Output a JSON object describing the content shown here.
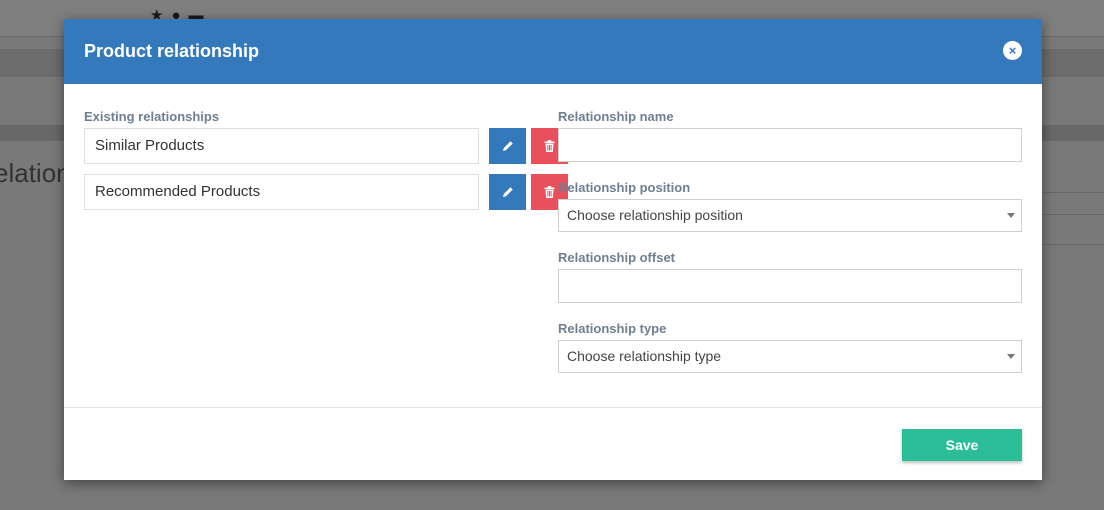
{
  "background": {
    "heading_fragment": "elation"
  },
  "modal": {
    "title": "Product relationship",
    "close_symbol": "×"
  },
  "existing": {
    "label": "Existing relationships",
    "items": [
      {
        "name": "Similar Products"
      },
      {
        "name": "Recommended Products"
      }
    ]
  },
  "form": {
    "name_label": "Relationship name",
    "name_value": "",
    "position_label": "Relationship position",
    "position_selected": "Choose relationship position",
    "offset_label": "Relationship offset",
    "offset_value": "",
    "type_label": "Relationship type",
    "type_selected": "Choose relationship type"
  },
  "footer": {
    "save_label": "Save"
  },
  "colors": {
    "header": "#3479bc",
    "edit": "#3479bc",
    "delete": "#e9505c",
    "save": "#2bbd98",
    "label": "#6f7f91"
  },
  "icons": [
    "star-icon",
    "user-icon",
    "cart-icon",
    "close-icon",
    "pencil-icon",
    "trash-icon",
    "chevron-down-icon"
  ]
}
